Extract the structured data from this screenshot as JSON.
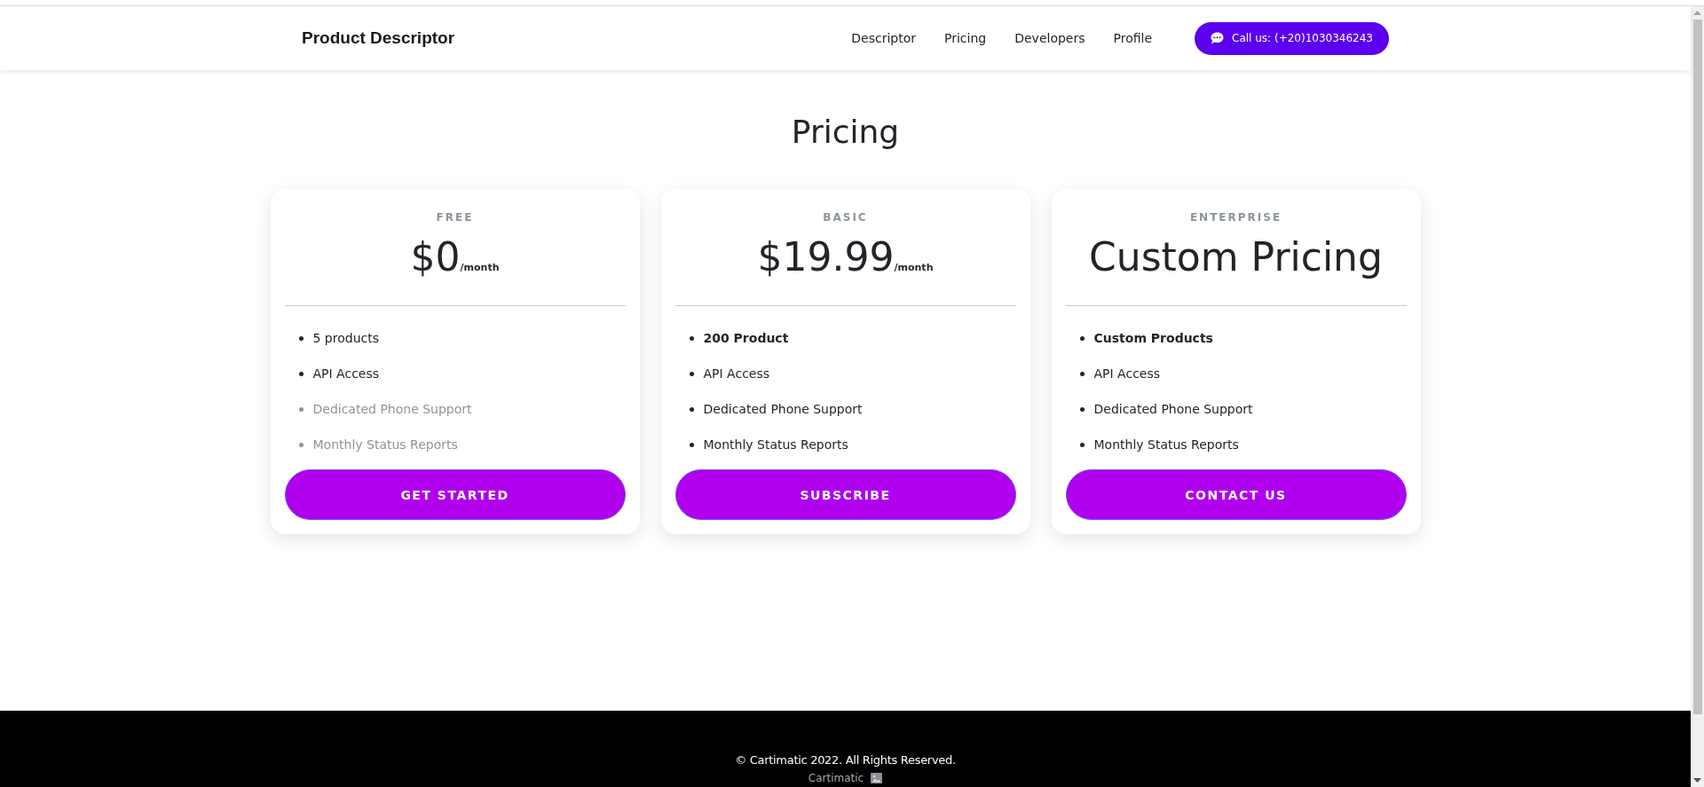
{
  "navbar": {
    "brand": "Product Descriptor",
    "links": [
      "Descriptor",
      "Pricing",
      "Developers",
      "Profile"
    ],
    "call_button": "Call us: (+20)1030346243"
  },
  "page_title": "Pricing",
  "plans": [
    {
      "tier": "FREE",
      "price": "$0",
      "period": "/month",
      "features": [
        {
          "text": "5 products",
          "included": true,
          "emphasized": false
        },
        {
          "text": "API Access",
          "included": true,
          "emphasized": false
        },
        {
          "text": "Dedicated Phone Support",
          "included": false,
          "emphasized": false
        },
        {
          "text": "Monthly Status Reports",
          "included": false,
          "emphasized": false
        }
      ],
      "button": "GET STARTED"
    },
    {
      "tier": "BASIC",
      "price": "$19.99",
      "period": "/month",
      "features": [
        {
          "text": "200 Product",
          "included": true,
          "emphasized": true
        },
        {
          "text": "API Access",
          "included": true,
          "emphasized": false
        },
        {
          "text": "Dedicated Phone Support",
          "included": true,
          "emphasized": false
        },
        {
          "text": "Monthly Status Reports",
          "included": true,
          "emphasized": false
        }
      ],
      "button": "SUBSCRIBE"
    },
    {
      "tier": "ENTERPRISE",
      "price": "Custom Pricing",
      "features": [
        {
          "text": "Custom Products",
          "included": true,
          "emphasized": true
        },
        {
          "text": "API Access",
          "included": true,
          "emphasized": false
        },
        {
          "text": "Dedicated Phone Support",
          "included": true,
          "emphasized": false
        },
        {
          "text": "Monthly Status Reports",
          "included": true,
          "emphasized": false
        }
      ],
      "button": "CONTACT US"
    }
  ],
  "footer": {
    "copyright": "© Cartimatic 2022. All Rights Reserved.",
    "credit": "Cartimatic"
  }
}
